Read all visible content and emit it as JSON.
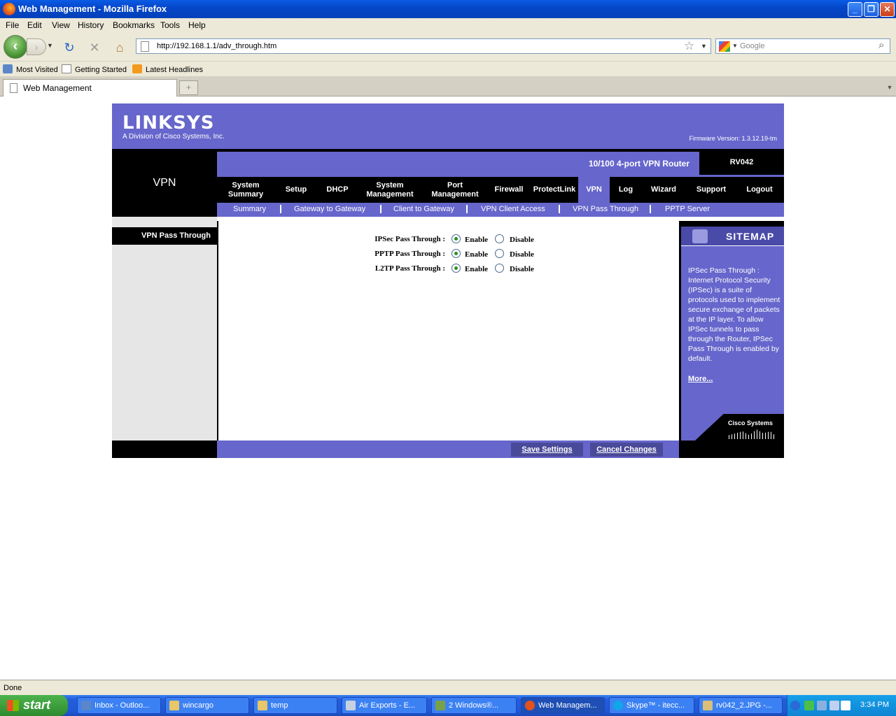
{
  "browser": {
    "title": "Web Management - Mozilla Firefox",
    "menu": [
      "File",
      "Edit",
      "View",
      "History",
      "Bookmarks",
      "Tools",
      "Help"
    ],
    "url": "http://192.168.1.1/adv_through.htm",
    "search_placeholder": "Google",
    "bookmarks": [
      "Most Visited",
      "Getting Started",
      "Latest Headlines"
    ],
    "tab_title": "Web Management",
    "new_tab": "+",
    "status": "Done"
  },
  "router": {
    "logo": "LINKSYS",
    "logo_sub": "A Division of Cisco Systems, Inc.",
    "firmware": "Firmware Version: 1.3.12.19-tm",
    "section": "VPN",
    "model_name": "10/100 4-port VPN Router",
    "model_code": "RV042",
    "nav": [
      {
        "label": "System\nSummary"
      },
      {
        "label": "Setup"
      },
      {
        "label": "DHCP"
      },
      {
        "label": "System\nManagement"
      },
      {
        "label": "Port\nManagement"
      },
      {
        "label": "Firewall"
      },
      {
        "label": "ProtectLink"
      },
      {
        "label": "VPN",
        "active": true
      },
      {
        "label": "Log"
      },
      {
        "label": "Wizard"
      },
      {
        "label": "Support"
      },
      {
        "label": "Logout"
      }
    ],
    "subnav": [
      "Summary",
      "Gateway to Gateway",
      "Client to Gateway",
      "VPN Client Access",
      "VPN Pass Through",
      "PPTP Server"
    ],
    "side_label": "VPN Pass Through",
    "rows": [
      {
        "label": "IPSec Pass Through :",
        "enable": "Enable",
        "disable": "Disable",
        "enabled": true
      },
      {
        "label": "PPTP Pass Through :",
        "enable": "Enable",
        "disable": "Disable",
        "enabled": true
      },
      {
        "label": "L2TP Pass Through :",
        "enable": "Enable",
        "disable": "Disable",
        "enabled": true
      }
    ],
    "sitemap_title": "SITEMAP",
    "sitemap_text": "IPSec Pass Through : Internet Protocol Security (IPSec) is a suite of protocols used to implement secure exchange of packets at the IP layer. To allow IPSec tunnels to pass through the Router, IPSec Pass Through is enabled by default.",
    "more": "More...",
    "cisco": "Cisco Systems",
    "save": "Save Settings",
    "cancel": "Cancel Changes",
    "accent": "#6666cc"
  },
  "taskbar": {
    "start": "start",
    "tasks": [
      "Inbox - Outloo...",
      "wincargo",
      "temp",
      "Air Exports - E...",
      "2 Windows®...",
      "Web Managem...",
      "Skype™ - itecc...",
      "rv042_2.JPG -..."
    ],
    "clock": "3:34 PM"
  }
}
